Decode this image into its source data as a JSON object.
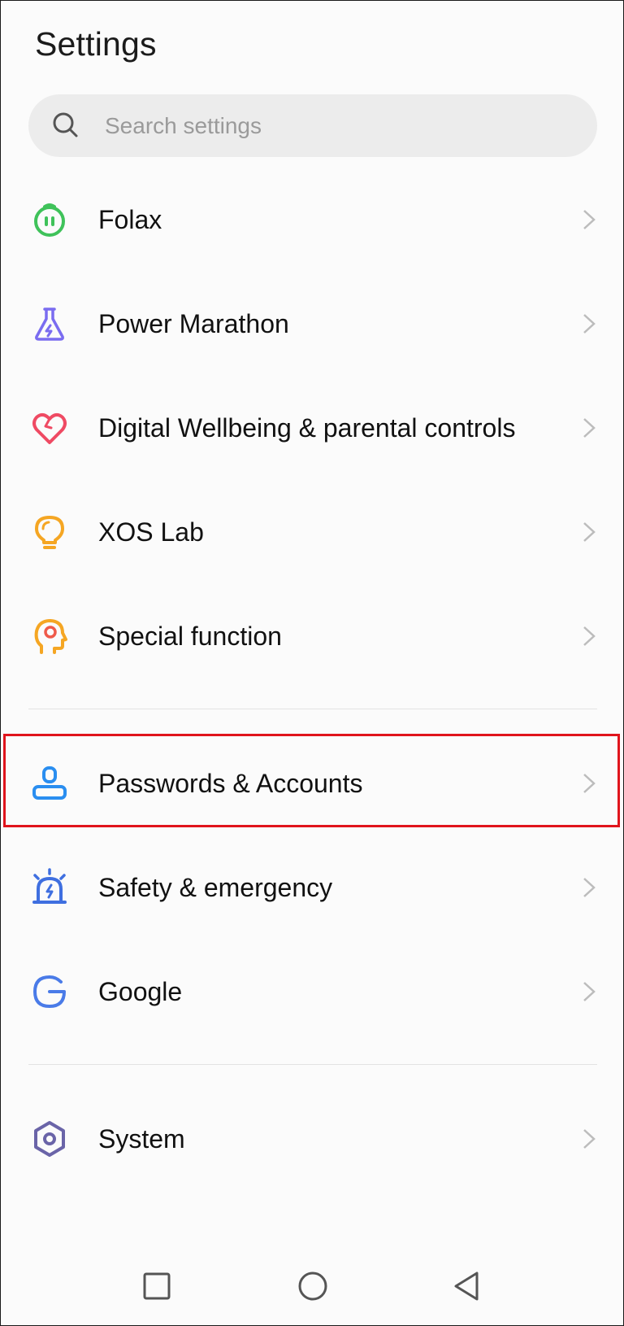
{
  "header": {
    "title": "Settings"
  },
  "search": {
    "placeholder": "Search settings",
    "icon": "search-icon"
  },
  "items": [
    {
      "id": "folax",
      "label": "Folax",
      "icon": "folax-icon",
      "color": "#3fc25a"
    },
    {
      "id": "power-marathon",
      "label": "Power Marathon",
      "icon": "flask-icon",
      "color": "#7a6cf0"
    },
    {
      "id": "digital-wellbeing",
      "label": "Digital Wellbeing & parental controls",
      "icon": "heart-icon",
      "color": "#ef4a63"
    },
    {
      "id": "xos-lab",
      "label": "XOS Lab",
      "icon": "lightbulb-icon",
      "color": "#f5a623"
    },
    {
      "id": "special-function",
      "label": "Special function",
      "icon": "head-icon",
      "color": "#f5a623"
    },
    {
      "id": "passwords-accounts",
      "label": "Passwords & Accounts",
      "icon": "account-icon",
      "color": "#2a8ef0"
    },
    {
      "id": "safety-emergency",
      "label": "Safety & emergency",
      "icon": "alarm-icon",
      "color": "#3f6fe0"
    },
    {
      "id": "google",
      "label": "Google",
      "icon": "google-icon",
      "color": "#4a7be8"
    },
    {
      "id": "system",
      "label": "System",
      "icon": "hexagon-gear-icon",
      "color": "#6a64a8"
    }
  ],
  "highlight_color": "#e0141c",
  "navbar": {
    "recent": "square-icon",
    "home": "circle-icon",
    "back": "triangle-back-icon"
  }
}
